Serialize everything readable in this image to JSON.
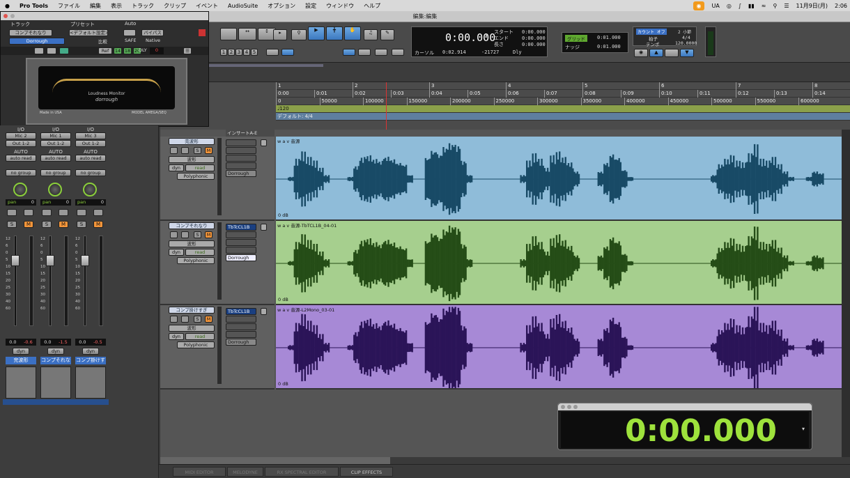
{
  "menubar": {
    "apple": "",
    "app": "Pro Tools",
    "items": [
      "ファイル",
      "編集",
      "表示",
      "トラック",
      "クリップ",
      "イベント",
      "AudioSuite",
      "オプション",
      "設定",
      "ウィンドウ",
      "ヘルプ"
    ],
    "lang": "UA",
    "date": "11月9日(月)",
    "time": "2:06"
  },
  "window_title": "編集:編集",
  "plugin": {
    "col_track": "トラック",
    "col_preset": "プリセット",
    "col_auto": "Auto",
    "track_name": "コンプそれなり",
    "preset": "<デフォルト設定>",
    "plugin_name": "Dorrough",
    "compare": "比較",
    "safe": "SAFE",
    "bypass": "バイパス",
    "native": "Native",
    "ref": "Ref",
    "num1": "14",
    "num2": "18",
    "num3": "20",
    "dly": "DLY",
    "dly_val": "0",
    "meter_title": "Loudness Monitor",
    "meter_brand": "dorrough",
    "made": "Made in USA",
    "model": "MODEL AMEGA/SEQ"
  },
  "toolbar": {
    "main_time": "0:00.000",
    "start_label": "スタート",
    "end_label": "エンド",
    "length_label": "長さ",
    "start": "0:00.000",
    "end": "0:00.000",
    "length": "0:00.000",
    "cursor_label": "カーソル",
    "cursor": "0:02.914",
    "cursor_val": "-21727",
    "dly": "Dly",
    "grid_label": "グリッド",
    "grid": "0:01.000",
    "nudge_label": "ナッジ",
    "nudge": "0:01.000",
    "count_off": "カウント オフ",
    "meter_label": "拍子",
    "tempo_label": "テンポ",
    "meter": "4/4",
    "tempo": "120.0000",
    "bars": "2 小節",
    "zoom_nums": [
      "1",
      "2",
      "3",
      "4",
      "5"
    ]
  },
  "rulers": {
    "bars": [
      "1",
      "2",
      "3",
      "4",
      "5",
      "6",
      "7",
      "8"
    ],
    "mins": [
      "0:00",
      "0:01",
      "0:02",
      "0:03",
      "0:04",
      "0:05",
      "0:06",
      "0:07",
      "0:08",
      "0:09",
      "0:10",
      "0:11",
      "0:12",
      "0:13",
      "0:14"
    ],
    "samples": [
      "0",
      "50000",
      "100000",
      "150000",
      "200000",
      "250000",
      "300000",
      "350000",
      "400000",
      "450000",
      "500000",
      "550000",
      "600000"
    ],
    "tempo": "♩120",
    "meter": "デフォルト: 4/4"
  },
  "mixer": {
    "io": "I/O",
    "auto": "AUTO",
    "no_group": "no group",
    "auto_read": "auto read",
    "pan": "pan",
    "pan_val": "0",
    "dyn": "dyn",
    "scale": [
      "12",
      "6",
      "0",
      "5",
      "10",
      "15",
      "20",
      "25",
      "30",
      "40",
      "60"
    ],
    "strips": [
      {
        "input": "Mic 2",
        "output": "Out 1-2",
        "v1": "0.0",
        "v2": "-0.6",
        "name": "完波形"
      },
      {
        "input": "Mic 1",
        "output": "Out 1-2",
        "v1": "0.0",
        "v2": "-1.5",
        "name": "コンプそれな"
      },
      {
        "input": "Mic 3",
        "output": "Out 1-2",
        "v1": "0.0",
        "v2": "-0.5",
        "name": "コンプ掛けす"
      }
    ]
  },
  "edit": {
    "insert_header": "インサートA-E",
    "tracks": [
      {
        "name": "完波形",
        "view": "波形",
        "dyn": "dyn",
        "read": "read",
        "poly": "Polyphonic",
        "insert1": "",
        "insert2": "Dorrough",
        "clip": "w a v 音源",
        "db": "0 dB",
        "color": "#8fbcd9",
        "wave": "#184a66"
      },
      {
        "name": "コンプそれなり",
        "view": "波形",
        "dyn": "dyn",
        "read": "read",
        "poly": "Polyphonic",
        "insert1": "TbTcCL1B",
        "insert2": "Dorrough",
        "clip": "w a v 音源-TbTCL1B_04-01",
        "db": "0 dB",
        "color": "#a6cf8e",
        "wave": "#254d17"
      },
      {
        "name": "コンプ掛けすぎ",
        "view": "波形",
        "dyn": "dyn",
        "read": "read",
        "poly": "Polyphonic",
        "insert1": "TbTcCL1B",
        "insert2": "Dorrough",
        "clip": "w a v 音源-L2Mono_03-01",
        "db": "0 dB",
        "color": "#a789d6",
        "wave": "#2b1458"
      }
    ],
    "s": "S",
    "m": "M"
  },
  "bigcounter": {
    "value": "0:00.000"
  },
  "bottom_tabs": [
    "MIDI EDITOR",
    "MELODYNE",
    "RX SPECTRAL EDITOR",
    "CLIP EFFECTS"
  ]
}
